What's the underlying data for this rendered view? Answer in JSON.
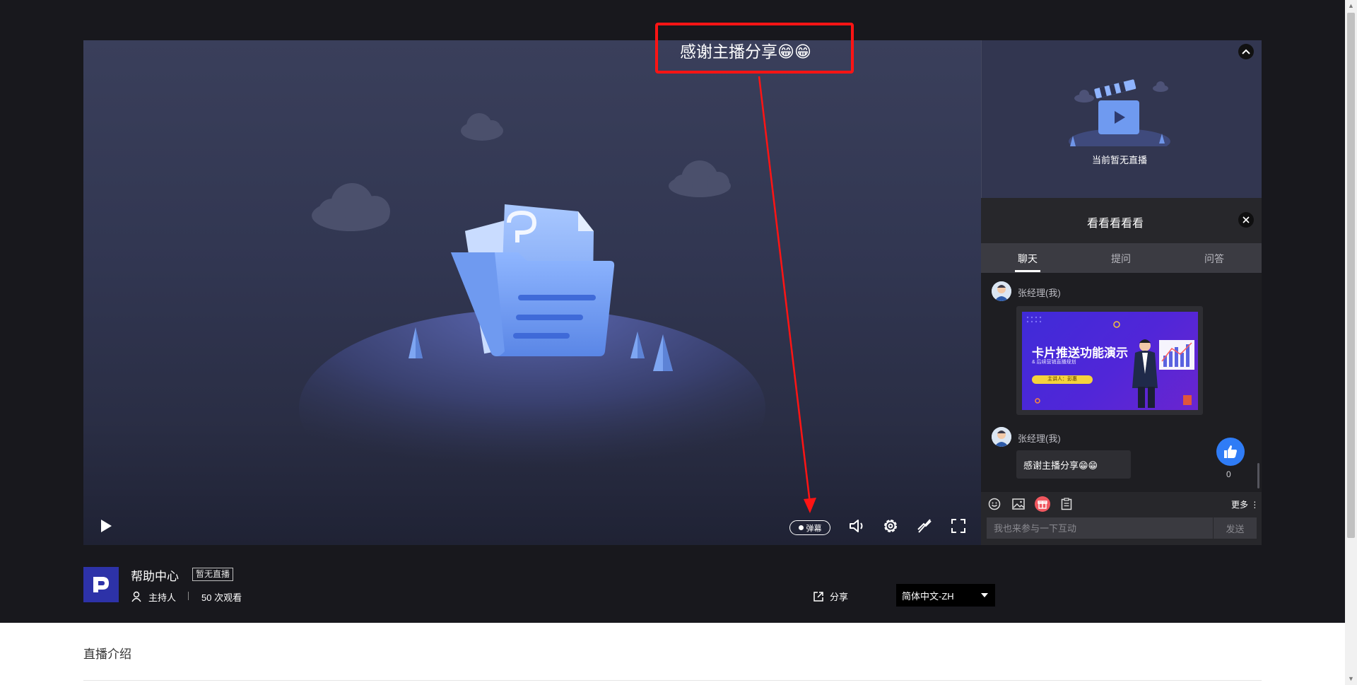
{
  "video": {
    "danmaku_label": "弹幕",
    "overlay_comment": "感谢主播分享😁😁"
  },
  "side": {
    "nolive_text": "当前暂无直播"
  },
  "chat": {
    "title": "看看看看看",
    "tabs": [
      "聊天",
      "提问",
      "问答"
    ],
    "messages": [
      {
        "user": "张经理(我)",
        "type": "card",
        "card_title": "卡片推送功能演示",
        "card_subtitle": "& 后续营销直播规划",
        "card_presenter": "主讲人：彭惠"
      },
      {
        "user": "张经理(我)",
        "type": "text",
        "text": "感谢主播分享😁😁"
      }
    ],
    "like_count": "0",
    "more_label": "更多",
    "input_placeholder": "我也来参与一下互动",
    "send_label": "发送"
  },
  "info": {
    "channel_name": "帮助中心",
    "status": "暂无直播",
    "host_label": "主持人",
    "viewers": "50 次观看",
    "share_label": "分享",
    "language": "简体中文-ZH"
  },
  "intro": {
    "title": "直播介绍"
  },
  "colors": {
    "highlight_border": "#ff1414",
    "like_blue": "#2f7cf6",
    "logo_bg": "#2d32a8"
  }
}
